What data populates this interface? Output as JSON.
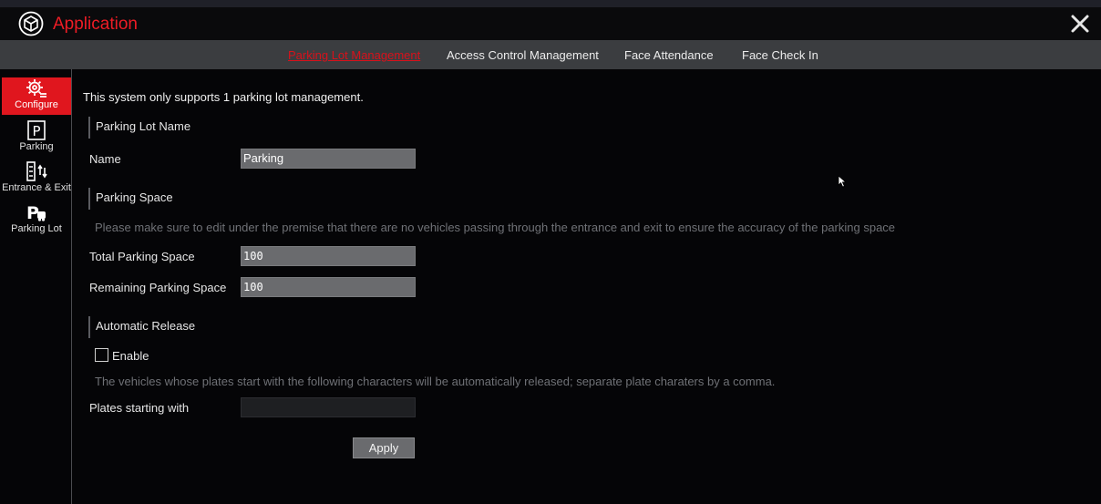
{
  "app": {
    "title": "Application",
    "accent": "#ee1c25"
  },
  "tabs": [
    {
      "label": "Parking Lot Management",
      "active": true
    },
    {
      "label": "Access Control Management"
    },
    {
      "label": "Face Attendance"
    },
    {
      "label": "Face Check In"
    }
  ],
  "sidebar": {
    "items": [
      {
        "label": "Configure",
        "icon": "gear-icon",
        "active": true
      },
      {
        "label": "Parking",
        "icon": "parking-icon"
      },
      {
        "label": "Entrance & Exit",
        "icon": "entrance-exit-icon"
      },
      {
        "label": "Parking Lot",
        "icon": "parking-lot-icon"
      }
    ]
  },
  "main": {
    "intro": "This system only supports 1 parking lot management.",
    "lot_name": {
      "section": "Parking Lot Name",
      "name_label": "Name",
      "name_value": "Parking"
    },
    "space": {
      "section": "Parking Space",
      "hint": "Please make sure to edit under the premise that there are no vehicles passing through the entrance and exit to ensure the accuracy of the parking space",
      "total_label": "Total Parking Space",
      "total_value": "100",
      "remaining_label": "Remaining Parking Space",
      "remaining_value": "100"
    },
    "release": {
      "section": "Automatic Release",
      "enable_label": "Enable",
      "enable_checked": false,
      "hint": "The vehicles whose plates start with the following characters will be automatically released; separate plate charaters by a comma.",
      "plates_label": "Plates starting with",
      "plates_value": ""
    },
    "apply_label": "Apply"
  }
}
